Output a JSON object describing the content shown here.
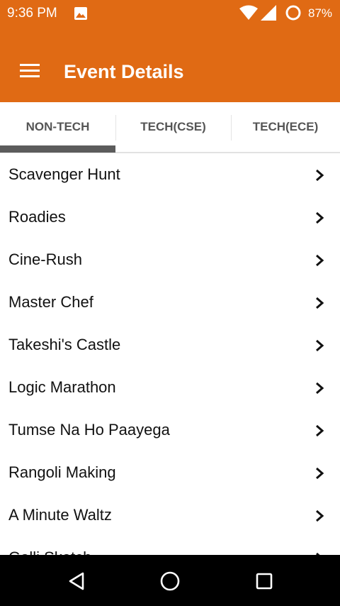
{
  "status_bar": {
    "time": "9:36 PM",
    "battery_percent": "87%",
    "icons": [
      "gallery-icon",
      "wifi-icon",
      "signal-icon",
      "battery-icon"
    ]
  },
  "app_bar": {
    "title": "Event Details",
    "menu_icon": "menu-icon",
    "color": "#e06a14"
  },
  "tabs": [
    {
      "label": "NON-TECH",
      "selected": true
    },
    {
      "label": "TECH(CSE)",
      "selected": false
    },
    {
      "label": "TECH(ECE)",
      "selected": false
    }
  ],
  "events": [
    {
      "name": "Scavenger Hunt"
    },
    {
      "name": "Roadies"
    },
    {
      "name": "Cine-Rush"
    },
    {
      "name": "Master Chef"
    },
    {
      "name": "Takeshi's Castle"
    },
    {
      "name": "Logic Marathon"
    },
    {
      "name": "Tumse Na Ho Paayega"
    },
    {
      "name": "Rangoli Making"
    },
    {
      "name": "A Minute Waltz"
    },
    {
      "name": "Galli Sketch"
    }
  ],
  "nav_bar": {
    "icons": [
      "back-icon",
      "home-icon",
      "recents-icon"
    ]
  }
}
